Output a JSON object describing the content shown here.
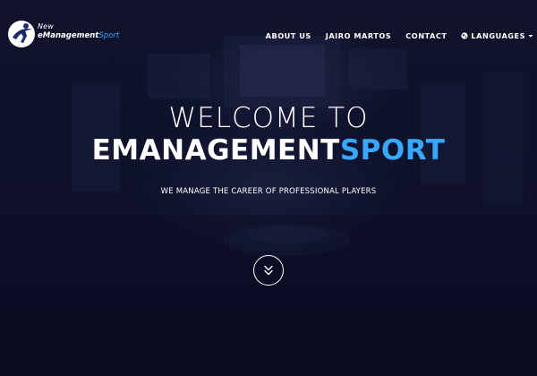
{
  "logo": {
    "prefix": "New",
    "name_primary": "eManagement",
    "name_accent": "Sport"
  },
  "nav": {
    "items": [
      {
        "label": "ABOUT US"
      },
      {
        "label": "JAIRO MARTOS"
      },
      {
        "label": "CONTACT"
      }
    ],
    "languages": {
      "label": "LANGUAGES",
      "icon": "globe-icon",
      "caret": "caret-down-icon"
    }
  },
  "hero": {
    "welcome": "WELCOME TO",
    "brand_primary": "EMANAGEMENT",
    "brand_accent": "SPORT",
    "tagline": "WE MANAGE THE CAREER OF PROFESSIONAL PLAYERS",
    "scroll_icon": "double-chevron-down-icon"
  },
  "colors": {
    "accent": "#3aa7ff",
    "text": "#ffffff",
    "background": "#0d0f24"
  }
}
